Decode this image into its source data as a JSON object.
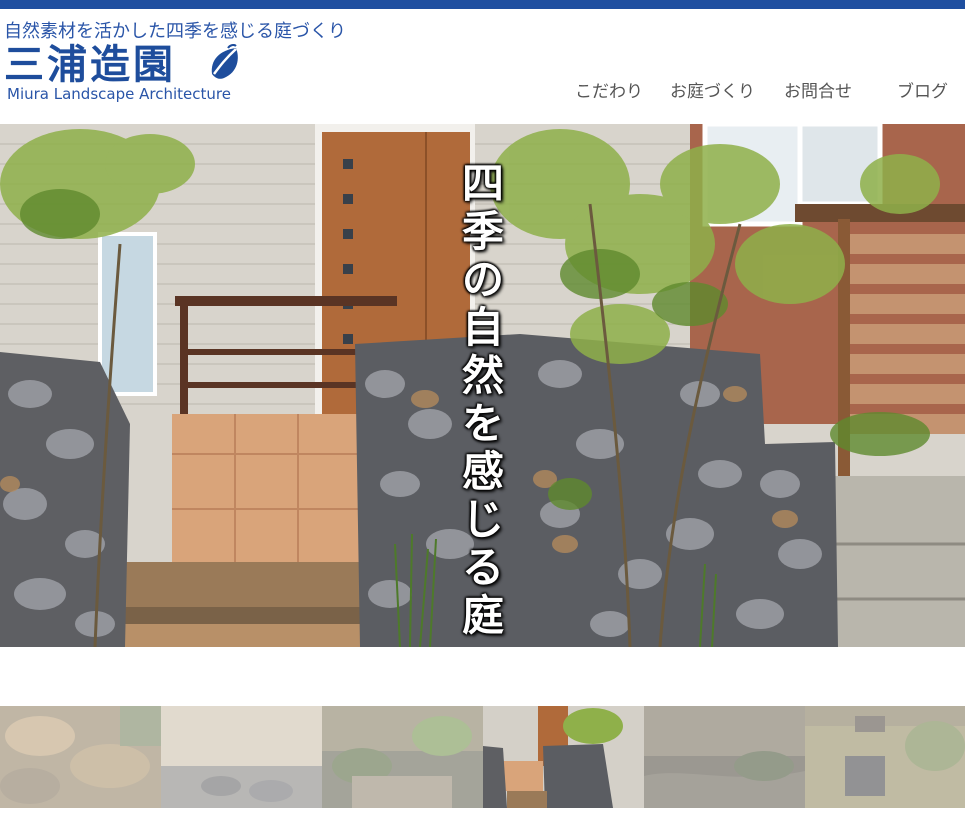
{
  "header": {
    "tagline": "自然素材を活かした四季を感じる庭づくり",
    "logo_text": "三浦造園",
    "logo_en": "Miura Landscape Architecture"
  },
  "nav": {
    "items": [
      {
        "label": "こだわり"
      },
      {
        "label": "お庭づくり"
      },
      {
        "label": "お問合せ"
      },
      {
        "label": "ブログ"
      }
    ]
  },
  "hero": {
    "caption_chars": [
      "四",
      "季",
      "の",
      "自",
      "然",
      "を",
      "感",
      "じ",
      "る",
      "庭"
    ]
  },
  "thumbnails": {
    "count": 6,
    "active_index": 3
  },
  "colors": {
    "brand_blue": "#1e4d9c",
    "top_bar": "#1f4fa0",
    "nav_text": "#555555"
  }
}
